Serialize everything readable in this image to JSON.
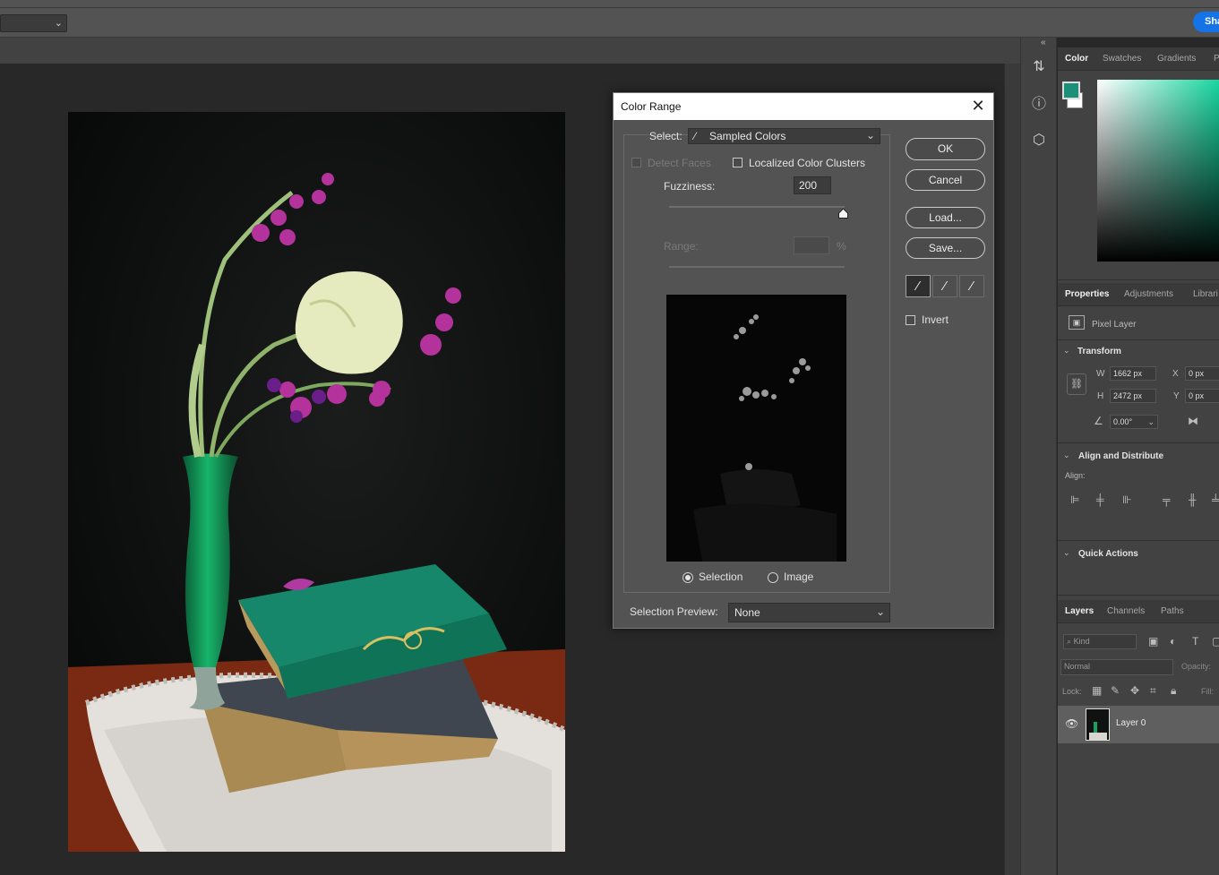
{
  "topbar": {
    "options_dropdown_value": "",
    "share_label": "Sha"
  },
  "dialog": {
    "title": "Color Range",
    "select_label": "Select:",
    "select_value": "Sampled Colors",
    "detect_faces_label": "Detect Faces",
    "localized_clusters_label": "Localized Color Clusters",
    "fuzziness_label": "Fuzziness:",
    "fuzziness_value": "200",
    "range_label": "Range:",
    "range_value": "",
    "range_unit": "%",
    "fuzziness_level": 1.0,
    "preview_mode_selection": "Selection",
    "preview_mode_image": "Image",
    "selection_preview_label": "Selection Preview:",
    "selection_preview_value": "None",
    "buttons": {
      "ok": "OK",
      "cancel": "Cancel",
      "load": "Load...",
      "save": "Save..."
    },
    "invert_label": "Invert"
  },
  "color_panel": {
    "tabs": [
      "Color",
      "Swatches",
      "Gradients",
      "P"
    ],
    "foreground_color": "#1b8f78",
    "background_color": "#ffffff"
  },
  "properties_panel": {
    "tabs": [
      "Properties",
      "Adjustments",
      "Librari"
    ],
    "layer_type": "Pixel Layer",
    "transform_title": "Transform",
    "w_label": "W",
    "w_value": "1662 px",
    "h_label": "H",
    "h_value": "2472 px",
    "x_label": "X",
    "x_value": "0 px",
    "y_label": "Y",
    "y_value": "0 px",
    "angle_value": "0.00°",
    "align_title": "Align and Distribute",
    "align_label": "Align:",
    "quick_actions_title": "Quick Actions"
  },
  "layers_panel": {
    "tabs": [
      "Layers",
      "Channels",
      "Paths"
    ],
    "kind_placeholder": "Kind",
    "blend_mode": "Normal",
    "opacity_label": "Opacity:",
    "lock_label": "Lock:",
    "fill_label": "Fill:",
    "layer_name": "Layer 0"
  }
}
